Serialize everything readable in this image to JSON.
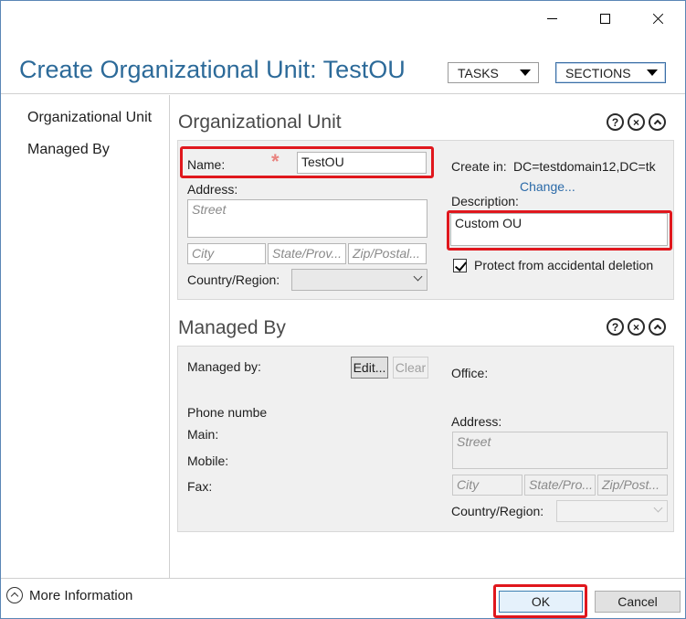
{
  "window": {
    "minimize_label": "",
    "maximize_label": "",
    "close_label": ""
  },
  "header": {
    "title": "Create Organizational Unit: TestOU",
    "tasks_label": "TASKS",
    "sections_label": "SECTIONS"
  },
  "nav": {
    "items": [
      {
        "label": "Organizational Unit"
      },
      {
        "label": "Managed By"
      }
    ]
  },
  "org_unit": {
    "section_title": "Organizational Unit",
    "help_icon": "?",
    "close_icon": "×",
    "name_label": "Name:",
    "required_marker": "*",
    "name_value": "TestOU",
    "address_label": "Address:",
    "street_placeholder": "Street",
    "city_placeholder": "City",
    "state_placeholder": "State/Prov...",
    "zip_placeholder": "Zip/Postal...",
    "country_label": "Country/Region:",
    "create_in_label": "Create in:",
    "create_in_value": "DC=testdomain12,DC=tk",
    "change_link": "Change...",
    "description_label": "Description:",
    "description_value": "Custom OU",
    "protect_label": "Protect from accidental deletion",
    "protect_checked": true
  },
  "managed_by": {
    "section_title": "Managed By",
    "help_icon": "?",
    "close_icon": "×",
    "managed_by_label": "Managed by:",
    "edit_label": "Edit...",
    "clear_label": "Clear",
    "phone_label": "Phone numbe",
    "main_label": "Main:",
    "mobile_label": "Mobile:",
    "fax_label": "Fax:",
    "office_label": "Office:",
    "address_label": "Address:",
    "street_placeholder": "Street",
    "city_placeholder": "City",
    "state_placeholder": "State/Pro...",
    "zip_placeholder": "Zip/Post...",
    "country_label": "Country/Region:"
  },
  "footer": {
    "more_info_label": "More Information",
    "ok_label": "OK",
    "cancel_label": "Cancel"
  },
  "colors": {
    "title_blue": "#2c6a99",
    "highlight_red": "#e0171d",
    "link_blue": "#2b6aa8",
    "panel_gray": "#f0f0f0"
  }
}
